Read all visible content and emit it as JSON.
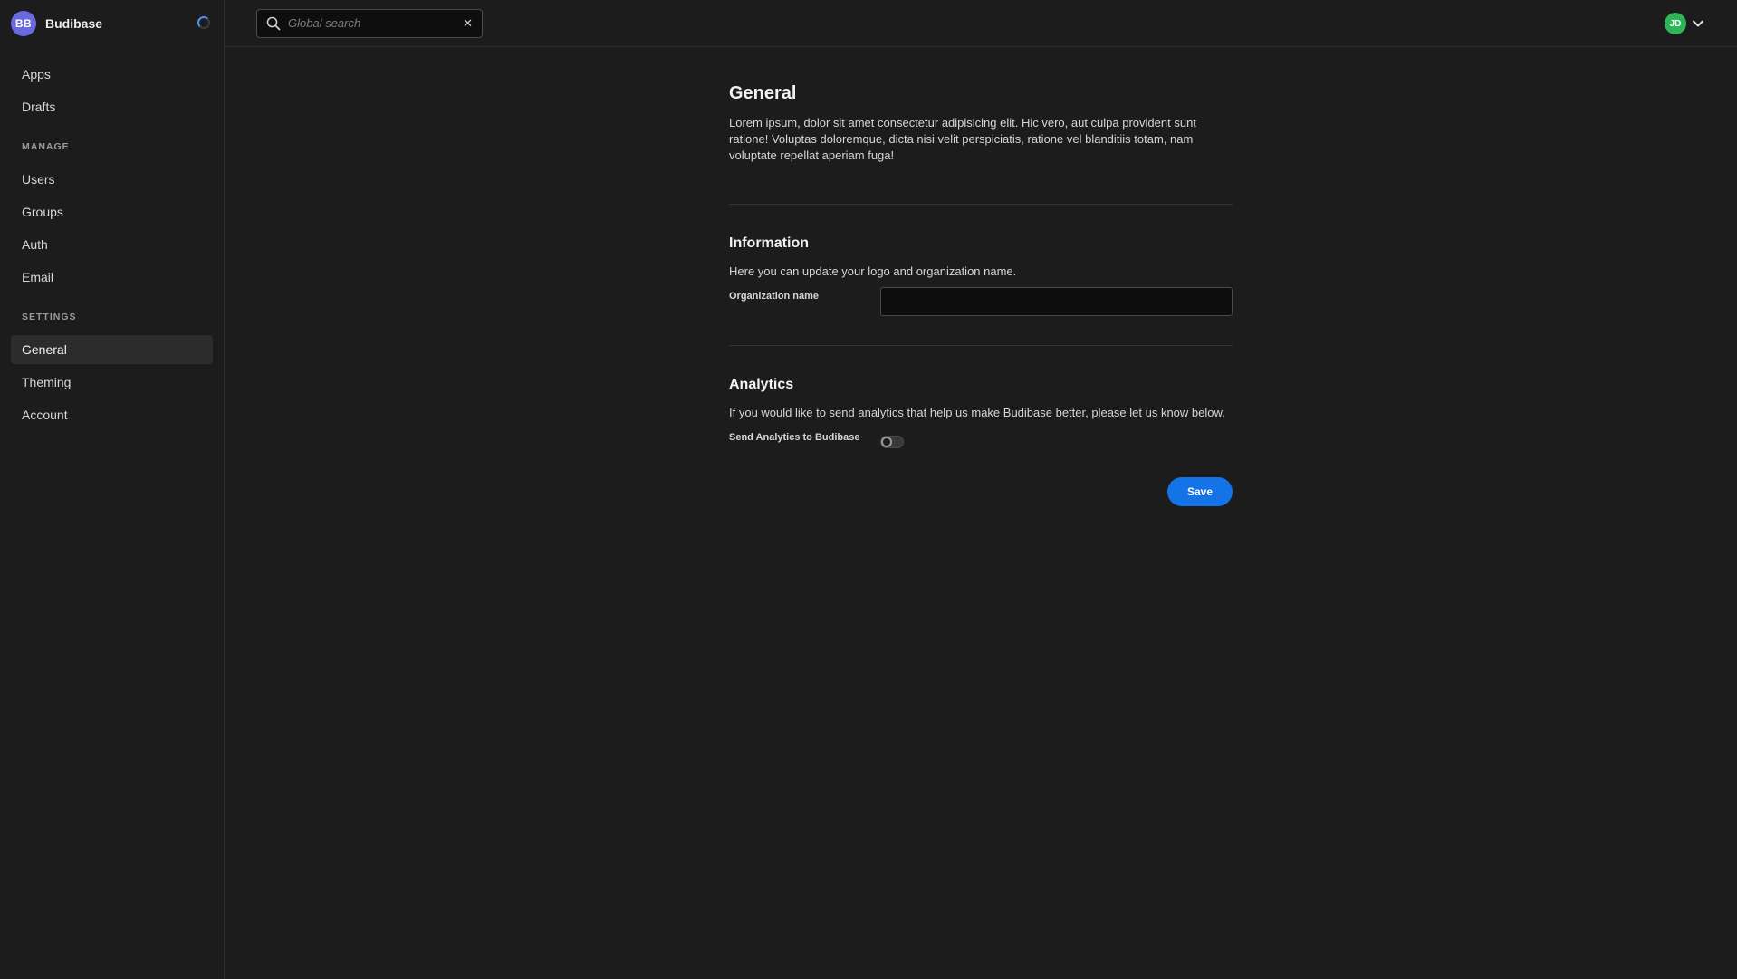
{
  "brand": {
    "initials": "BB",
    "name": "Budibase"
  },
  "sidebar": {
    "top_items": [
      {
        "label": "Apps"
      },
      {
        "label": "Drafts"
      }
    ],
    "manage_heading": "MANAGE",
    "manage_items": [
      {
        "label": "Users"
      },
      {
        "label": "Groups"
      },
      {
        "label": "Auth"
      },
      {
        "label": "Email"
      }
    ],
    "settings_heading": "SETTINGS",
    "settings_items": [
      {
        "label": "General",
        "active": true
      },
      {
        "label": "Theming"
      },
      {
        "label": "Account"
      }
    ]
  },
  "topbar": {
    "search_placeholder": "Global search",
    "search_value": "",
    "clear_icon": "✕",
    "user_initials": "JD"
  },
  "page": {
    "title": "General",
    "description": "Lorem ipsum, dolor sit amet consectetur adipisicing elit. Hic vero, aut culpa provident sunt ratione! Voluptas doloremque, dicta nisi velit perspiciatis, ratione vel blanditiis totam, nam voluptate repellat aperiam fuga!"
  },
  "information": {
    "title": "Information",
    "description": "Here you can update your logo and organization name.",
    "org_label": "Organization name",
    "org_value": ""
  },
  "analytics": {
    "title": "Analytics",
    "description": "If you would like to send analytics that help us make Budibase better, please let us know below.",
    "toggle_label": "Send Analytics to Budibase",
    "toggle_on": false
  },
  "actions": {
    "save_label": "Save"
  },
  "colors": {
    "background": "#1c1c1c",
    "accent": "#1473e6",
    "brand_avatar": "#6a6ae0",
    "user_avatar": "#2fb45a"
  }
}
